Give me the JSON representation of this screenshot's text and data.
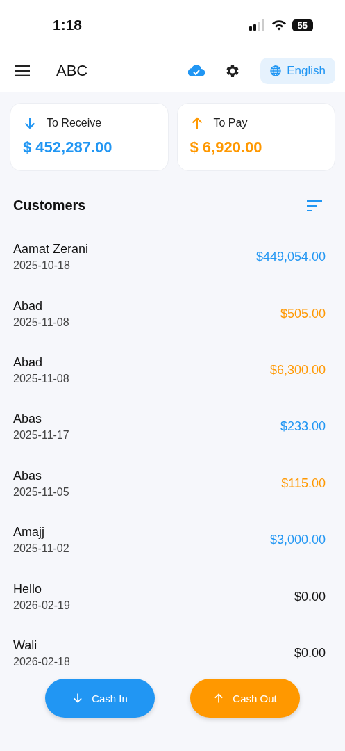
{
  "status_bar": {
    "time": "1:18",
    "battery": "55"
  },
  "header": {
    "title": "ABC",
    "language": "English"
  },
  "summary": [
    {
      "kind": "receive",
      "label": "To Receive",
      "amount": "$ 452,287.00"
    },
    {
      "kind": "pay",
      "label": "To Pay",
      "amount": "$ 6,920.00"
    }
  ],
  "customers": {
    "title": "Customers",
    "rows": [
      {
        "name": "Aamat Zerani",
        "date": "2025-10-18",
        "amount": "$449,054.00",
        "kind": "receive"
      },
      {
        "name": "Abad",
        "date": "2025-11-08",
        "amount": "$505.00",
        "kind": "pay"
      },
      {
        "name": "Abad",
        "date": "2025-11-08",
        "amount": "$6,300.00",
        "kind": "pay"
      },
      {
        "name": "Abas",
        "date": "2025-11-17",
        "amount": "$233.00",
        "kind": "receive"
      },
      {
        "name": "Abas",
        "date": "2025-11-05",
        "amount": "$115.00",
        "kind": "pay"
      },
      {
        "name": "Amajj",
        "date": "2025-11-02",
        "amount": "$3,000.00",
        "kind": "receive"
      },
      {
        "name": "Hello",
        "date": "2026-02-19",
        "amount": "$0.00",
        "kind": "zero"
      },
      {
        "name": "Wali",
        "date": "2026-02-18",
        "amount": "$0.00",
        "kind": "zero"
      }
    ]
  },
  "actions": [
    {
      "kind": "in",
      "label": "Cash In"
    },
    {
      "kind": "out",
      "label": "Cash Out"
    }
  ]
}
